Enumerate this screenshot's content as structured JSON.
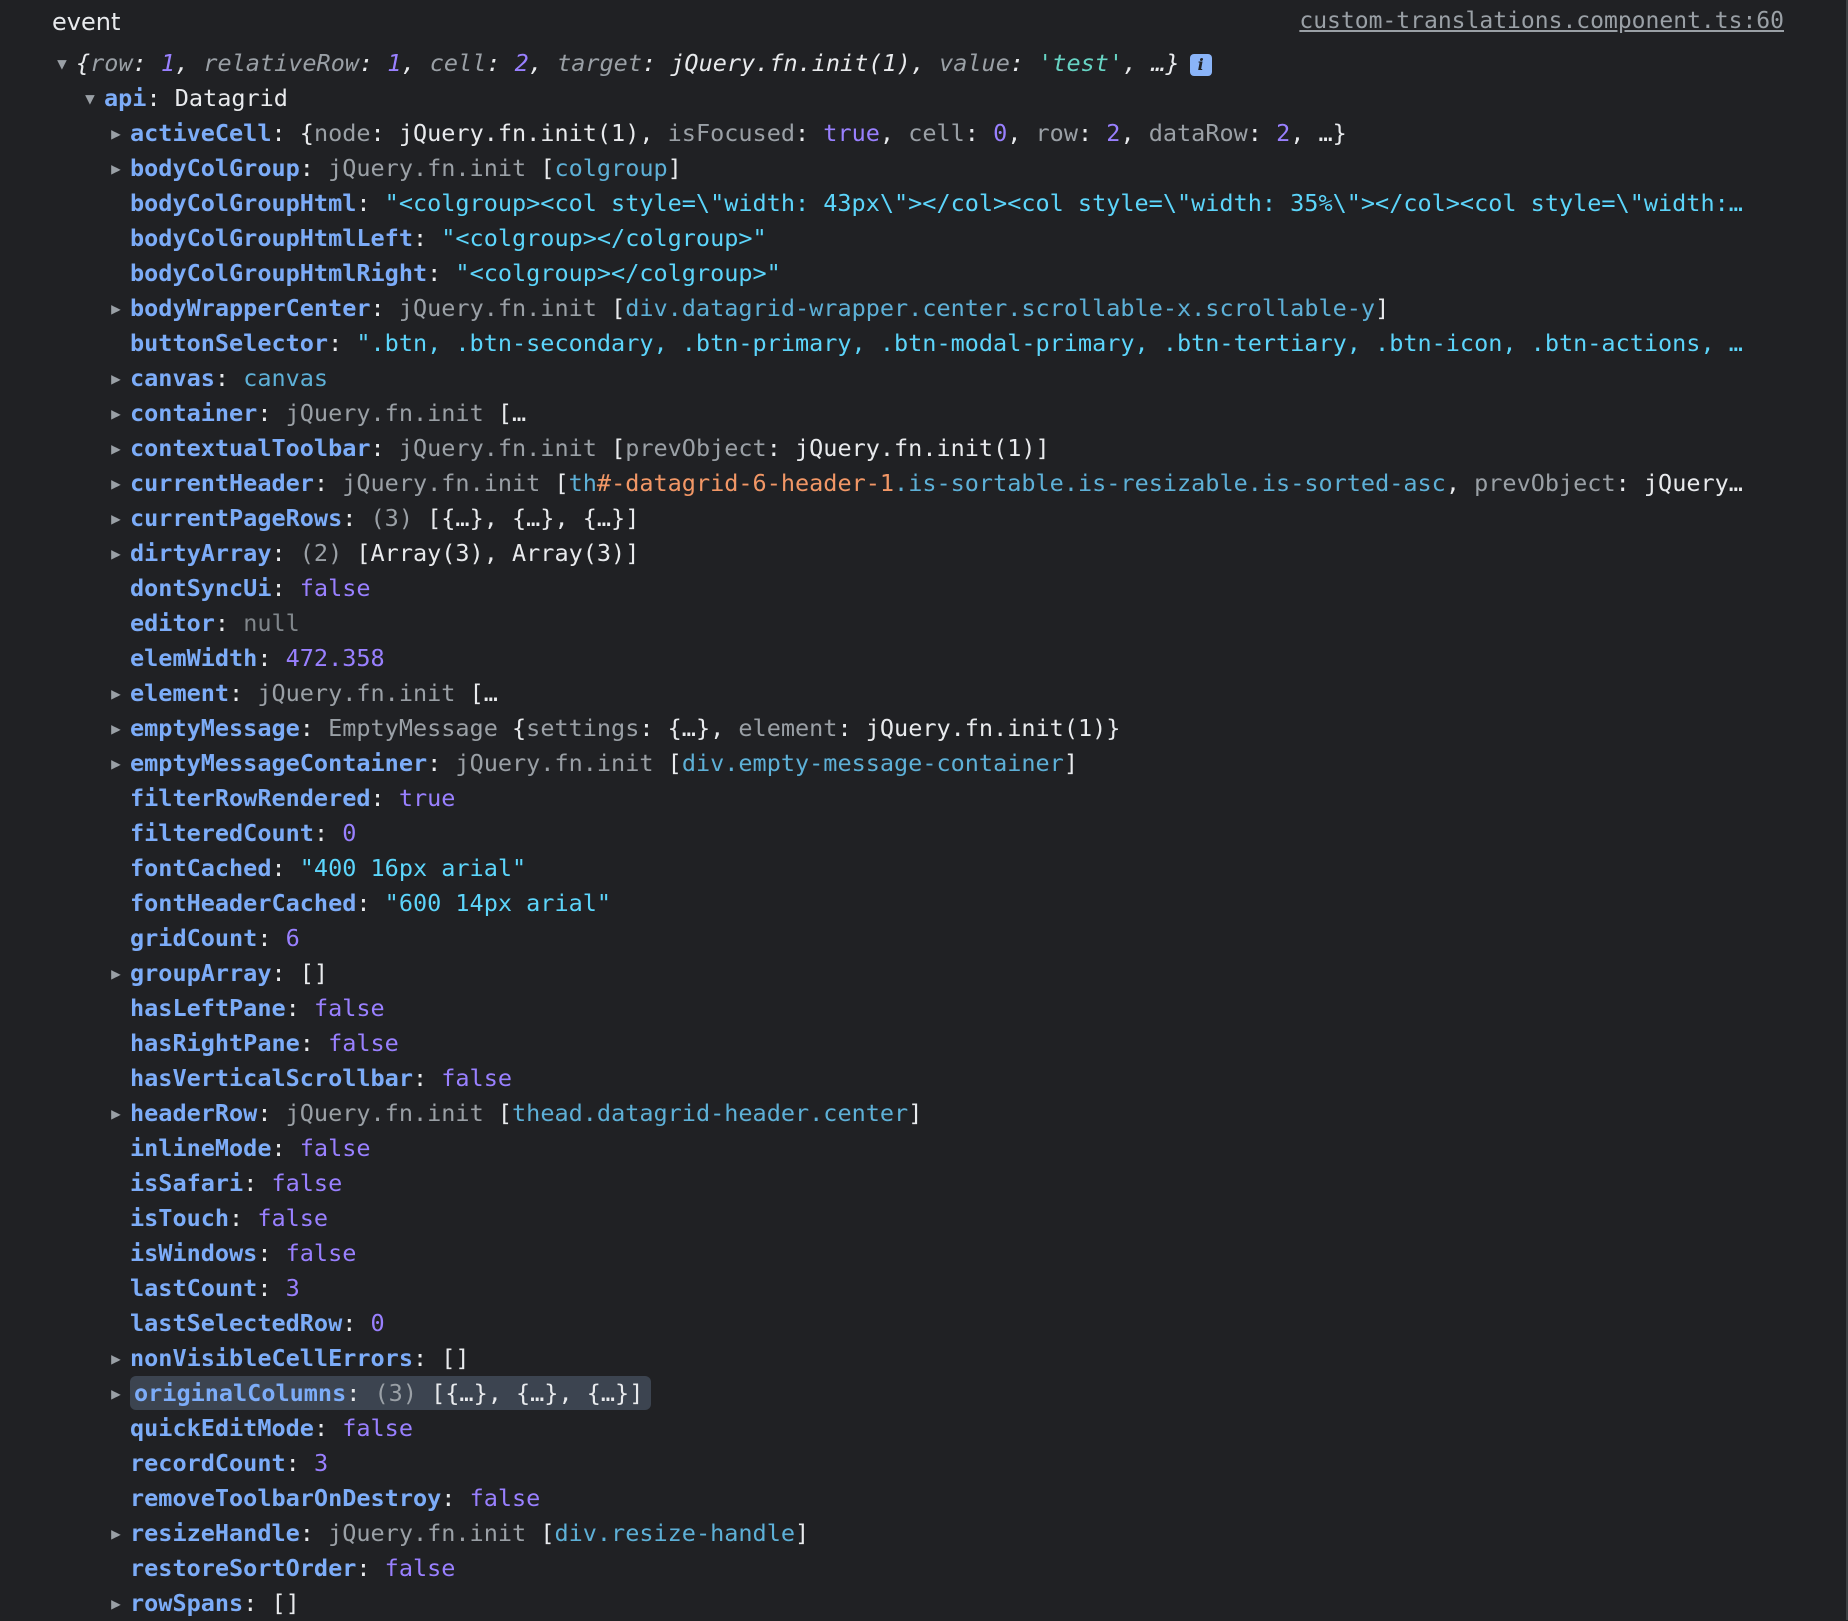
{
  "header": {
    "label": "event",
    "source_link": "custom-translations.component.ts:60"
  },
  "root": {
    "preview_parts": [
      {
        "t": "punc",
        "v": "{"
      },
      {
        "t": "ikey",
        "v": "row"
      },
      {
        "t": "punc",
        "v": ": "
      },
      {
        "t": "num",
        "v": "1"
      },
      {
        "t": "punc",
        "v": ", "
      },
      {
        "t": "ikey",
        "v": "relativeRow"
      },
      {
        "t": "punc",
        "v": ": "
      },
      {
        "t": "num",
        "v": "1"
      },
      {
        "t": "punc",
        "v": ", "
      },
      {
        "t": "ikey",
        "v": "cell"
      },
      {
        "t": "punc",
        "v": ": "
      },
      {
        "t": "num",
        "v": "2"
      },
      {
        "t": "punc",
        "v": ", "
      },
      {
        "t": "ikey",
        "v": "target"
      },
      {
        "t": "punc",
        "v": ": "
      },
      {
        "t": "plain",
        "v": "jQuery.fn.init(1)"
      },
      {
        "t": "punc",
        "v": ", "
      },
      {
        "t": "ikey",
        "v": "value"
      },
      {
        "t": "punc",
        "v": ": "
      },
      {
        "t": "strq",
        "v": "'test'"
      },
      {
        "t": "punc",
        "v": ", …}"
      }
    ],
    "info_badge": "i"
  },
  "api": {
    "key": "api",
    "type": "Datagrid"
  },
  "properties": [
    {
      "key": "activeCell",
      "expandable": true,
      "parts": [
        {
          "t": "punc",
          "v": "{"
        },
        {
          "t": "gray",
          "v": "node"
        },
        {
          "t": "punc",
          "v": ": jQuery.fn.init(1), "
        },
        {
          "t": "gray",
          "v": "isFocused"
        },
        {
          "t": "punc",
          "v": ": "
        },
        {
          "t": "bool",
          "v": "true"
        },
        {
          "t": "punc",
          "v": ", "
        },
        {
          "t": "gray",
          "v": "cell"
        },
        {
          "t": "punc",
          "v": ": "
        },
        {
          "t": "num",
          "v": "0"
        },
        {
          "t": "punc",
          "v": ", "
        },
        {
          "t": "gray",
          "v": "row"
        },
        {
          "t": "punc",
          "v": ": "
        },
        {
          "t": "num",
          "v": "2"
        },
        {
          "t": "punc",
          "v": ", "
        },
        {
          "t": "gray",
          "v": "dataRow"
        },
        {
          "t": "punc",
          "v": ": "
        },
        {
          "t": "num",
          "v": "2"
        },
        {
          "t": "punc",
          "v": ", …}"
        }
      ]
    },
    {
      "key": "bodyColGroup",
      "expandable": true,
      "parts": [
        {
          "t": "cls",
          "v": "jQuery.fn.init "
        },
        {
          "t": "punc",
          "v": "["
        },
        {
          "t": "tag",
          "v": "colgroup"
        },
        {
          "t": "punc",
          "v": "]"
        }
      ]
    },
    {
      "key": "bodyColGroupHtml",
      "expandable": false,
      "parts": [
        {
          "t": "str",
          "v": "\"<colgroup><col style=\\\"width: 43px\\\"></col><col style=\\\"width: 35%\\\"></col><col style=\\\"width:…"
        }
      ]
    },
    {
      "key": "bodyColGroupHtmlLeft",
      "expandable": false,
      "parts": [
        {
          "t": "str",
          "v": "\"<colgroup></colgroup>\""
        }
      ]
    },
    {
      "key": "bodyColGroupHtmlRight",
      "expandable": false,
      "parts": [
        {
          "t": "str",
          "v": "\"<colgroup></colgroup>\""
        }
      ]
    },
    {
      "key": "bodyWrapperCenter",
      "expandable": true,
      "parts": [
        {
          "t": "cls",
          "v": "jQuery.fn.init "
        },
        {
          "t": "punc",
          "v": "["
        },
        {
          "t": "tag",
          "v": "div.datagrid-wrapper.center.scrollable-x.scrollable-y"
        },
        {
          "t": "punc",
          "v": "]"
        }
      ]
    },
    {
      "key": "buttonSelector",
      "expandable": false,
      "parts": [
        {
          "t": "str",
          "v": "\".btn, .btn-secondary, .btn-primary, .btn-modal-primary, .btn-tertiary, .btn-icon, .btn-actions, …"
        }
      ]
    },
    {
      "key": "canvas",
      "expandable": true,
      "parts": [
        {
          "t": "tag",
          "v": "canvas"
        }
      ]
    },
    {
      "key": "container",
      "expandable": true,
      "parts": [
        {
          "t": "cls",
          "v": "jQuery.fn.init "
        },
        {
          "t": "punc",
          "v": "[…"
        }
      ]
    },
    {
      "key": "contextualToolbar",
      "expandable": true,
      "parts": [
        {
          "t": "cls",
          "v": "jQuery.fn.init "
        },
        {
          "t": "punc",
          "v": "["
        },
        {
          "t": "gray",
          "v": "prevObject"
        },
        {
          "t": "punc",
          "v": ": jQuery.fn.init(1)]"
        }
      ]
    },
    {
      "key": "currentHeader",
      "expandable": true,
      "parts": [
        {
          "t": "cls",
          "v": "jQuery.fn.init "
        },
        {
          "t": "punc",
          "v": "["
        },
        {
          "t": "tag",
          "v": "th"
        },
        {
          "t": "idc",
          "v": "#-datagrid-6-header-1"
        },
        {
          "t": "tag",
          "v": ".is-sortable.is-resizable.is-sorted-asc"
        },
        {
          "t": "punc",
          "v": ", "
        },
        {
          "t": "gray",
          "v": "prevObject"
        },
        {
          "t": "punc",
          "v": ": jQuery…"
        }
      ]
    },
    {
      "key": "currentPageRows",
      "expandable": true,
      "parts": [
        {
          "t": "gray",
          "v": "(3) "
        },
        {
          "t": "punc",
          "v": "[{…}, {…}, {…}]"
        }
      ]
    },
    {
      "key": "dirtyArray",
      "expandable": true,
      "parts": [
        {
          "t": "gray",
          "v": "(2) "
        },
        {
          "t": "punc",
          "v": "[Array(3), Array(3)]"
        }
      ]
    },
    {
      "key": "dontSyncUi",
      "expandable": false,
      "parts": [
        {
          "t": "bool",
          "v": "false"
        }
      ]
    },
    {
      "key": "editor",
      "expandable": false,
      "parts": [
        {
          "t": "nul",
          "v": "null"
        }
      ]
    },
    {
      "key": "elemWidth",
      "expandable": false,
      "parts": [
        {
          "t": "num",
          "v": "472.358"
        }
      ]
    },
    {
      "key": "element",
      "expandable": true,
      "parts": [
        {
          "t": "cls",
          "v": "jQuery.fn.init "
        },
        {
          "t": "punc",
          "v": "[…"
        }
      ]
    },
    {
      "key": "emptyMessage",
      "expandable": true,
      "parts": [
        {
          "t": "cls",
          "v": "EmptyMessage "
        },
        {
          "t": "punc",
          "v": "{"
        },
        {
          "t": "gray",
          "v": "settings"
        },
        {
          "t": "punc",
          "v": ": {…}, "
        },
        {
          "t": "gray",
          "v": "element"
        },
        {
          "t": "punc",
          "v": ": jQuery.fn.init(1)}"
        }
      ]
    },
    {
      "key": "emptyMessageContainer",
      "expandable": true,
      "parts": [
        {
          "t": "cls",
          "v": "jQuery.fn.init "
        },
        {
          "t": "punc",
          "v": "["
        },
        {
          "t": "tag",
          "v": "div.empty-message-container"
        },
        {
          "t": "punc",
          "v": "]"
        }
      ]
    },
    {
      "key": "filterRowRendered",
      "expandable": false,
      "parts": [
        {
          "t": "bool",
          "v": "true"
        }
      ]
    },
    {
      "key": "filteredCount",
      "expandable": false,
      "parts": [
        {
          "t": "num",
          "v": "0"
        }
      ]
    },
    {
      "key": "fontCached",
      "expandable": false,
      "parts": [
        {
          "t": "str",
          "v": "\"400 16px arial\""
        }
      ]
    },
    {
      "key": "fontHeaderCached",
      "expandable": false,
      "parts": [
        {
          "t": "str",
          "v": "\"600 14px arial\""
        }
      ]
    },
    {
      "key": "gridCount",
      "expandable": false,
      "parts": [
        {
          "t": "num",
          "v": "6"
        }
      ]
    },
    {
      "key": "groupArray",
      "expandable": true,
      "parts": [
        {
          "t": "punc",
          "v": "[]"
        }
      ]
    },
    {
      "key": "hasLeftPane",
      "expandable": false,
      "parts": [
        {
          "t": "bool",
          "v": "false"
        }
      ]
    },
    {
      "key": "hasRightPane",
      "expandable": false,
      "parts": [
        {
          "t": "bool",
          "v": "false"
        }
      ]
    },
    {
      "key": "hasVerticalScrollbar",
      "expandable": false,
      "parts": [
        {
          "t": "bool",
          "v": "false"
        }
      ]
    },
    {
      "key": "headerRow",
      "expandable": true,
      "parts": [
        {
          "t": "cls",
          "v": "jQuery.fn.init "
        },
        {
          "t": "punc",
          "v": "["
        },
        {
          "t": "tag",
          "v": "thead.datagrid-header.center"
        },
        {
          "t": "punc",
          "v": "]"
        }
      ]
    },
    {
      "key": "inlineMode",
      "expandable": false,
      "parts": [
        {
          "t": "bool",
          "v": "false"
        }
      ]
    },
    {
      "key": "isSafari",
      "expandable": false,
      "parts": [
        {
          "t": "bool",
          "v": "false"
        }
      ]
    },
    {
      "key": "isTouch",
      "expandable": false,
      "parts": [
        {
          "t": "bool",
          "v": "false"
        }
      ]
    },
    {
      "key": "isWindows",
      "expandable": false,
      "parts": [
        {
          "t": "bool",
          "v": "false"
        }
      ]
    },
    {
      "key": "lastCount",
      "expandable": false,
      "parts": [
        {
          "t": "num",
          "v": "3"
        }
      ]
    },
    {
      "key": "lastSelectedRow",
      "expandable": false,
      "parts": [
        {
          "t": "num",
          "v": "0"
        }
      ]
    },
    {
      "key": "nonVisibleCellErrors",
      "expandable": true,
      "parts": [
        {
          "t": "punc",
          "v": "[]"
        }
      ]
    },
    {
      "key": "originalColumns",
      "expandable": true,
      "selected": true,
      "parts": [
        {
          "t": "gray",
          "v": "(3) "
        },
        {
          "t": "punc",
          "v": "[{…}, {…}, {…}]"
        }
      ]
    },
    {
      "key": "quickEditMode",
      "expandable": false,
      "parts": [
        {
          "t": "bool",
          "v": "false"
        }
      ]
    },
    {
      "key": "recordCount",
      "expandable": false,
      "parts": [
        {
          "t": "num",
          "v": "3"
        }
      ]
    },
    {
      "key": "removeToolbarOnDestroy",
      "expandable": false,
      "parts": [
        {
          "t": "bool",
          "v": "false"
        }
      ]
    },
    {
      "key": "resizeHandle",
      "expandable": true,
      "parts": [
        {
          "t": "cls",
          "v": "jQuery.fn.init "
        },
        {
          "t": "punc",
          "v": "["
        },
        {
          "t": "tag",
          "v": "div.resize-handle"
        },
        {
          "t": "punc",
          "v": "]"
        }
      ]
    },
    {
      "key": "restoreSortOrder",
      "expandable": false,
      "parts": [
        {
          "t": "bool",
          "v": "false"
        }
      ]
    },
    {
      "key": "rowSpans",
      "expandable": true,
      "parts": [
        {
          "t": "punc",
          "v": "[]"
        }
      ]
    }
  ],
  "icons": {
    "expanded": "triangle-down-icon",
    "collapsed": "triangle-right-icon"
  },
  "colors": {
    "background": "#202124",
    "key": "#7cacf8",
    "number": "#9980ff",
    "string": "#5cd5fb",
    "id_selector": "#f29766",
    "selected_row": "#3c4450"
  }
}
